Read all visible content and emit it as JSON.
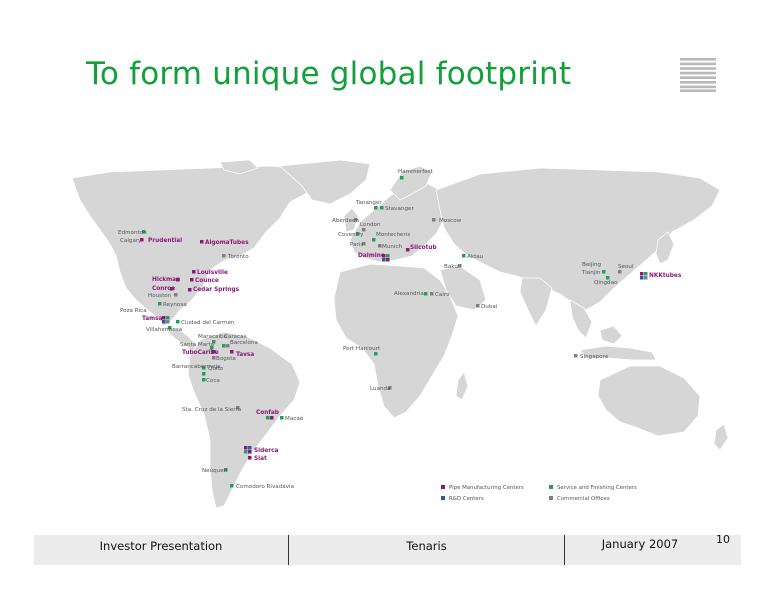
{
  "slide": {
    "title": "To form unique global footprint",
    "page_number": "10"
  },
  "colors": {
    "title_green": "#12a03a",
    "pipe_manufacturing": "#8a1a7a",
    "service_finishing": "#22a05a",
    "rnd": "#2a5aa8",
    "commercial": "#808080",
    "land": "#d9d9d9",
    "coast": "#ffffff"
  },
  "legend": {
    "pipe_manufacturing": "Pipe Manufacturing Centers",
    "service_finishing": "Service and Finishing Centers",
    "rnd": "R&D Centers",
    "commercial": "Commercial Offices"
  },
  "locations": {
    "hammerfest": "Hammerfest",
    "tananger": "Tananger",
    "stavanger": "Stavanger",
    "aberdeen": "Aberdeen",
    "moscow": "Moscow",
    "coventry": "Coventry",
    "london": "London",
    "paris": "Paris",
    "montecheris": "Montecheris",
    "munich": "Munich",
    "silcotub": "Silcotub",
    "dalmine": "Dalmine",
    "aktau": "Aktau",
    "baku": "Baku",
    "alexandria": "Alexandria",
    "cairo": "Cairo",
    "dubai": "Dubai",
    "beijing": "Beijing",
    "tianjin": "Tianjin",
    "seoul": "Seoul",
    "qingdao": "Qingdao",
    "nkktubes": "NKKtubes",
    "singapore": "Singapore",
    "port_harcourt": "Port Harcourt",
    "luanda": "Luanda",
    "edmonton": "Edmonton",
    "calgary": "Calgary",
    "prudential": "Prudential",
    "algomatubes": "AlgomaTubes",
    "toronto": "Toronto",
    "louisville": "Louisville",
    "hickman": "Hickman",
    "counce": "Counce",
    "conroe": "Conroe",
    "houston": "Houston",
    "cedar_springs": "Cedar Springs",
    "reynosa": "Reynosa",
    "poza_rica": "Poza Rica",
    "tamsa": "Tamsa",
    "ciudad_del_carmen": "Ciudad del Carmen",
    "villahermosa": "Villahermosa",
    "maracaibo": "Maracaibo",
    "caracas": "Caracas",
    "santa_marta": "Santa Marta",
    "barcelona": "Barcelona",
    "tubocaribe": "TuboCaribe",
    "tavsa": "Tavsa",
    "bogota": "Bogota",
    "barrancabermeja": "Barrancabermeja",
    "quito": "Quito",
    "coca": "Coca",
    "sta_cruz_de_la_sierra": "Sta. Cruz de la Sierra",
    "confab": "Confab",
    "macae": "Macaé",
    "siderca": "Siderca",
    "siat": "Siat",
    "neuquen": "Neuquen",
    "comodoro_rivadavia": "Comodoro Rivadavia"
  },
  "footer": {
    "left": "Investor Presentation",
    "center": "Tenaris",
    "right": "January  2007"
  }
}
